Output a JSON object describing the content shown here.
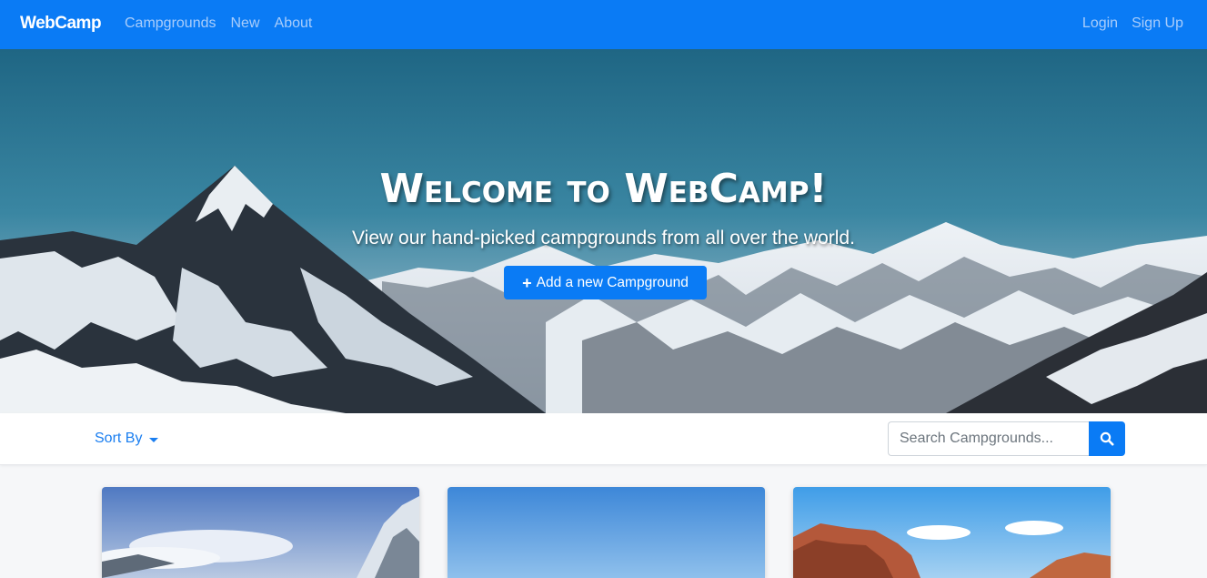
{
  "navbar": {
    "brand": "WebCamp",
    "left_links": [
      "Campgrounds",
      "New",
      "About"
    ],
    "right_links": [
      "Login",
      "Sign Up"
    ]
  },
  "hero": {
    "title": "Welcome to WebCamp!",
    "subtitle": "View our hand-picked campgrounds from all over the world.",
    "add_button_label": "Add a new Campground"
  },
  "toolbar": {
    "sort_label": "Sort By",
    "search_placeholder": "Search Campgrounds..."
  },
  "colors": {
    "primary": "#0a7bf5",
    "nav_link": "#a9cdfb"
  },
  "icons": {
    "add": "plus-icon",
    "search": "search-icon",
    "sort": "caret-down-icon"
  }
}
